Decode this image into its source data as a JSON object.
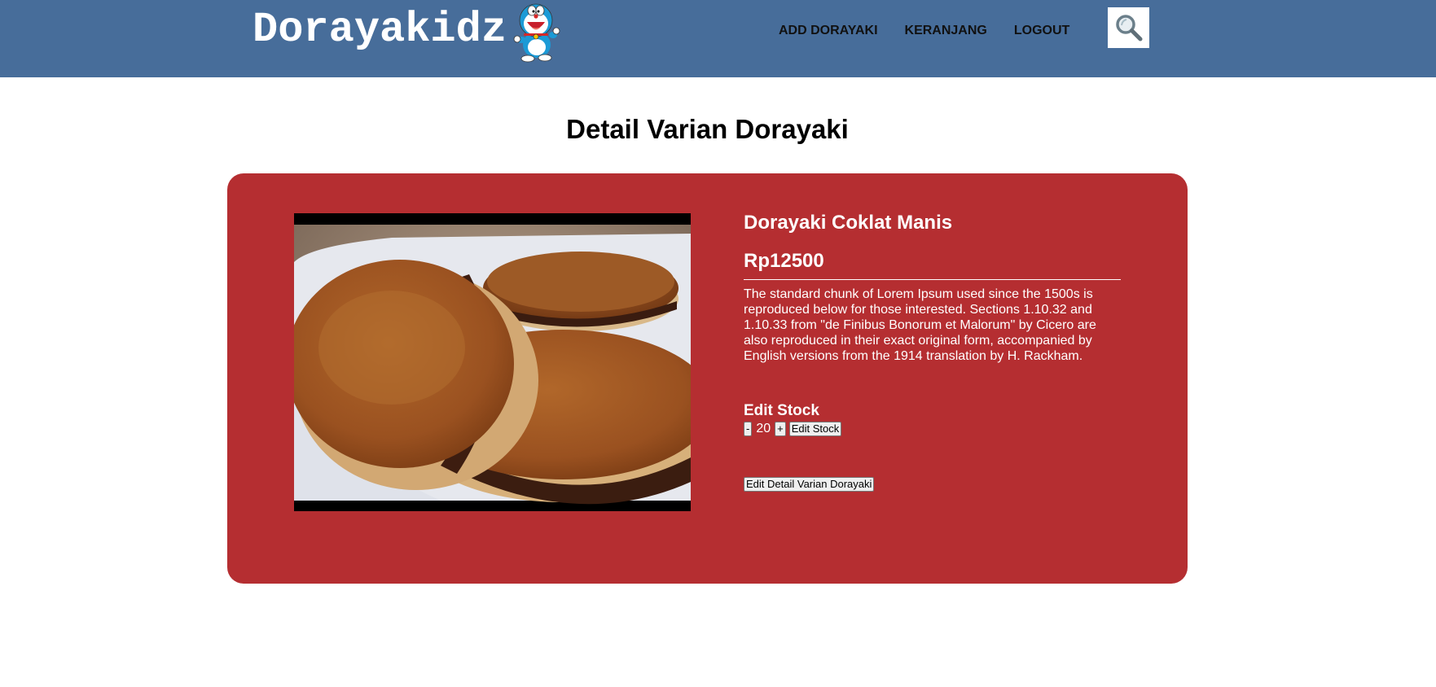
{
  "navbar": {
    "brand": "Dorayakidz",
    "links": [
      {
        "label": "ADD DORAYAKI"
      },
      {
        "label": "KERANJANG"
      },
      {
        "label": "LOGOUT"
      }
    ],
    "search_icon": "magnifier-icon",
    "color": "#476d9a"
  },
  "page": {
    "title": "Detail Varian Dorayaki"
  },
  "product": {
    "name": "Dorayaki Coklat Manis",
    "price": "Rp12500",
    "description": "The standard chunk of Lorem Ipsum used since the 1500s is reproduced below for those interested. Sections 1.10.32 and 1.10.33 from \"de Finibus Bonorum et Malorum\" by Cicero are also reproduced in their exact original form, accompanied by English versions from the 1914 translation by H. Rackham.",
    "card_color": "#b52e31"
  },
  "stock": {
    "label": "Edit Stock",
    "decrement_label": "-",
    "quantity": "20",
    "increment_label": "+",
    "submit_label": "Edit Stock"
  },
  "actions": {
    "edit_detail_label": "Edit Detail Varian Dorayaki"
  }
}
